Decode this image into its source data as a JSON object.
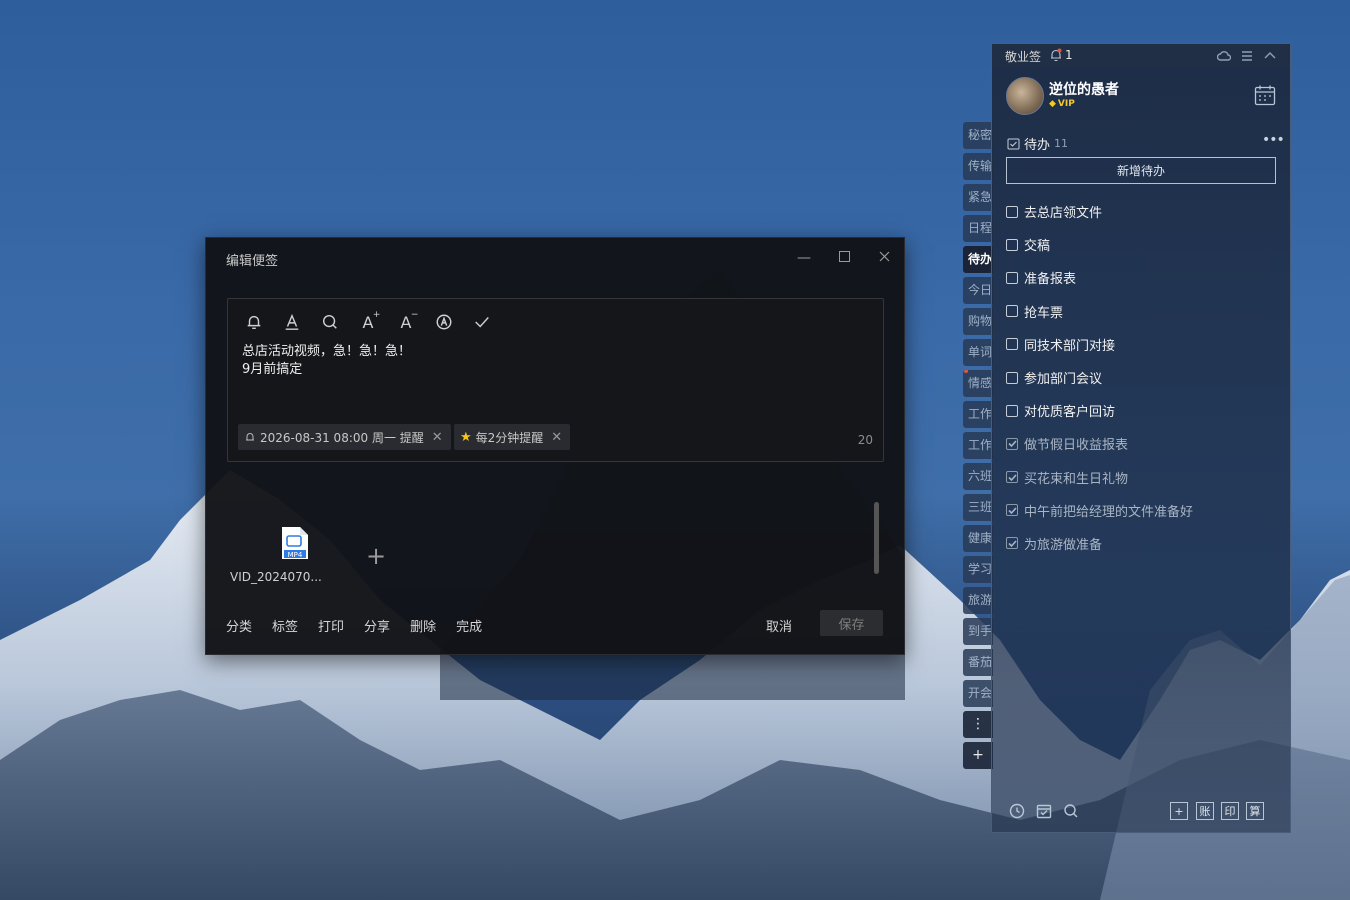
{
  "editor": {
    "title": "编辑便签",
    "note_lines": [
      "总店活动视频，急！急！急！",
      "9月前搞定"
    ],
    "reminder_chip": "2026-08-31 08:00 周一 提醒",
    "repeat_chip": "每2分钟提醒",
    "char_count": "20",
    "attachment_name": "VID_2024070...",
    "attachment_type": "MP4",
    "bottom_links": [
      "分类",
      "标签",
      "打印",
      "分享",
      "删除",
      "完成"
    ],
    "cancel_label": "取消",
    "save_label": "保存"
  },
  "side_tabs": [
    "秘密",
    "传输",
    "紧急",
    "日程",
    "待办",
    "今日",
    "购物",
    "单词",
    "情感",
    "工作",
    "工作",
    "六班",
    "三班",
    "健康",
    "学习",
    "旅游",
    "到手",
    "番茄",
    "开会"
  ],
  "side_tabs_active": "待办",
  "panel": {
    "app_title": "敬业签",
    "notification_count": "1",
    "user_name": "逆位的愚者",
    "vip_label": "VIP",
    "section_title": "待办",
    "section_count": "11",
    "new_todo_label": "新增待办",
    "todos": [
      {
        "text": "去总店领文件",
        "done": false
      },
      {
        "text": "交稿",
        "done": false
      },
      {
        "text": "准备报表",
        "done": false
      },
      {
        "text": "抢车票",
        "done": false
      },
      {
        "text": "同技术部门对接",
        "done": false
      },
      {
        "text": "参加部门会议",
        "done": false
      },
      {
        "text": "对优质客户回访",
        "done": false
      },
      {
        "text": "做节假日收益报表",
        "done": true
      },
      {
        "text": "买花束和生日礼物",
        "done": true
      },
      {
        "text": "中午前把给经理的文件准备好",
        "done": true
      },
      {
        "text": "为旅游做准备",
        "done": true
      }
    ],
    "footer_boxes": [
      "+",
      "账",
      "印",
      "算"
    ]
  },
  "colors": {
    "sky": "#3a6aa8",
    "dialog_bg": "#111216",
    "panel_bg": "#1c283e",
    "vip": "#f3c928"
  }
}
